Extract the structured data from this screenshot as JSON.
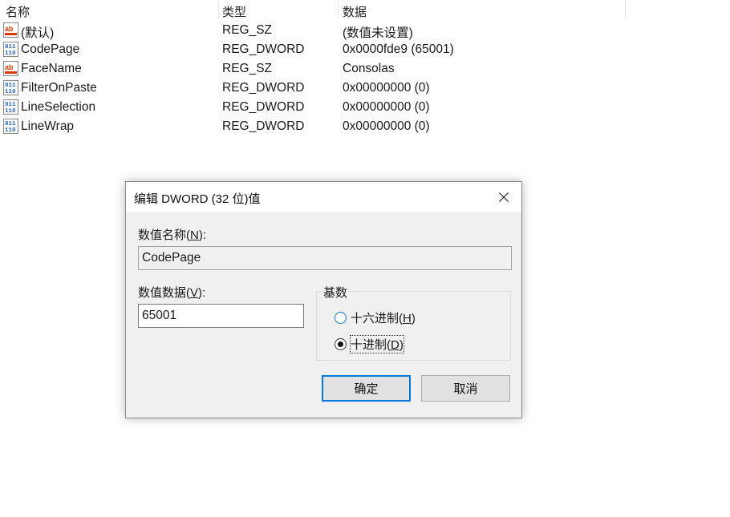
{
  "list": {
    "columns": [
      "名称",
      "类型",
      "数据"
    ],
    "rows": [
      {
        "name": "(默认)",
        "type": "REG_SZ",
        "data": "(数值未设置)",
        "icon": "string-value-icon"
      },
      {
        "name": "CodePage",
        "type": "REG_DWORD",
        "data": "0x0000fde9 (65001)",
        "icon": "binary-value-icon"
      },
      {
        "name": "FaceName",
        "type": "REG_SZ",
        "data": "Consolas",
        "icon": "string-value-icon"
      },
      {
        "name": "FilterOnPaste",
        "type": "REG_DWORD",
        "data": "0x00000000 (0)",
        "icon": "binary-value-icon"
      },
      {
        "name": "LineSelection",
        "type": "REG_DWORD",
        "data": "0x00000000 (0)",
        "icon": "binary-value-icon"
      },
      {
        "name": "LineWrap",
        "type": "REG_DWORD",
        "data": "0x00000000 (0)",
        "icon": "binary-value-icon"
      }
    ]
  },
  "dialog": {
    "title": "编辑 DWORD (32 位)值",
    "value_name_label_pre": "数值名称(",
    "value_name_label_key": "N",
    "value_name_label_post": "):",
    "value_name": "CodePage",
    "value_data_label_pre": "数值数据(",
    "value_data_label_key": "V",
    "value_data_label_post": "):",
    "value_data": "65001",
    "base_label": "基数",
    "hex_label_pre": "十六进制(",
    "hex_label_key": "H",
    "hex_label_post": ")",
    "hex_selected": false,
    "dec_label_pre": "十进制(",
    "dec_label_key": "D",
    "dec_label_post": ")",
    "dec_selected": true,
    "ok_label": "确定",
    "cancel_label": "取消"
  },
  "colors": {
    "accent": "#0078d7",
    "dialog_bg": "#f0f0f0",
    "icon_red": "#d83b01",
    "icon_blue": "#2b6cc4"
  }
}
